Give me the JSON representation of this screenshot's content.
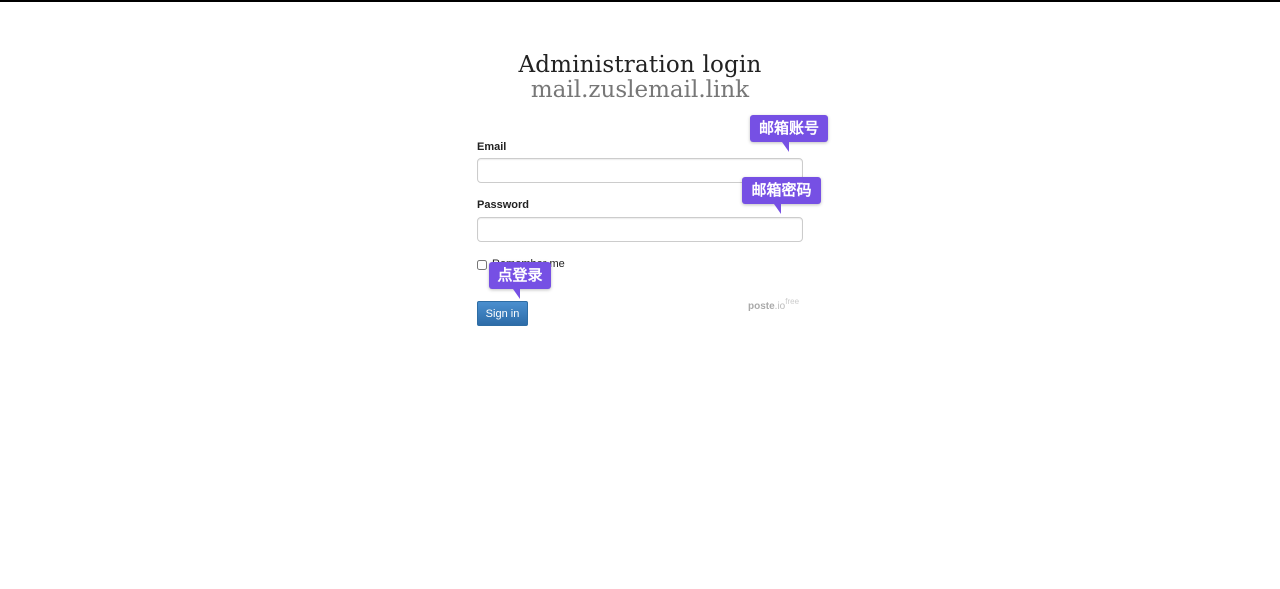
{
  "header": {
    "title": "Administration login",
    "subtitle": "mail.zuslemail.link"
  },
  "form": {
    "email_label": "Email",
    "email_value": "",
    "password_label": "Password",
    "password_value": "",
    "remember_label": "Remember me",
    "remember_checked": false,
    "signin_label": "Sign in"
  },
  "brand": {
    "name": "poste",
    "tld": ".io",
    "edition": "free"
  },
  "annotations": {
    "email_tip": "邮箱账号",
    "password_tip": "邮箱密码",
    "signin_tip": "点登录",
    "color": "#7650e4"
  }
}
